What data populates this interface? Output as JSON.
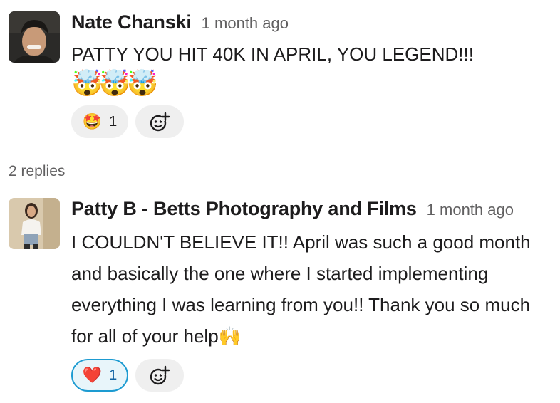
{
  "thread": {
    "messages": [
      {
        "author": "Nate Chanski",
        "time": "1 month ago",
        "text": "PATTY YOU HIT 40K IN APRIL, YOU LEGEND!!!",
        "emoji_line": "🤯🤯🤯",
        "reaction": {
          "emoji": "🤩",
          "count": "1",
          "active": false
        },
        "add_reaction_icon": "add-emoji-icon"
      },
      {
        "author": "Patty B - Betts Photography and Films",
        "time": "1 month ago",
        "text": "I COULDN'T BELIEVE IT!! April was such a good month and basically the one where I started implementing everything I was learning from you!! Thank you so much for all of your help🙌",
        "reaction": {
          "emoji": "❤️",
          "count": "1",
          "active": true
        },
        "add_reaction_icon": "add-emoji-icon"
      }
    ],
    "replies_label": "2 replies"
  },
  "colors": {
    "active_reaction_border": "#1d9bd1",
    "active_reaction_bg": "#e8f5fa",
    "divider": "#dddddd"
  }
}
